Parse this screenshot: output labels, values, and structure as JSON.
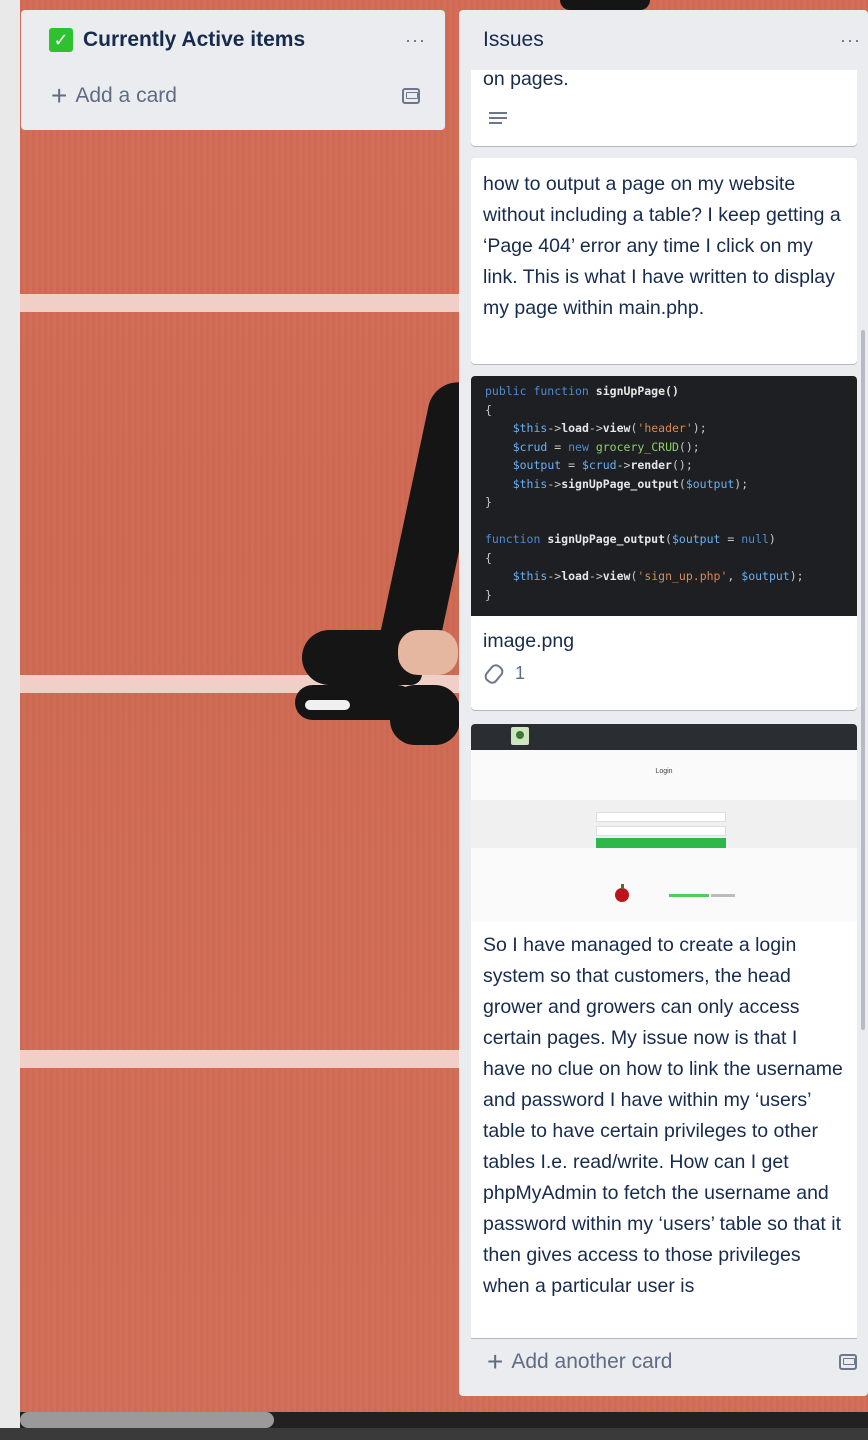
{
  "lists": {
    "active": {
      "title": "Currently Active items",
      "more": "···",
      "add_card": "Add a card"
    },
    "issues": {
      "title": "Issues",
      "more": "···",
      "add_card": "Add another card",
      "cards": [
        {
          "text": "on pages.",
          "has_description": true
        },
        {
          "text": "how to output a page on my website without including a table? I keep getting a ‘Page 404’ error any time I click on my link. This is what I have written to display my page within main.php."
        },
        {
          "attachment_name": "image.png",
          "attachment_count": "1"
        },
        {
          "text": "So I have managed to create a login system so that customers, the head grower and growers can only access certain pages. My issue now is that I have no clue on how to link the username and password I have within my ‘users’ table to have certain privileges to other tables I.e. read/write. How can I get phpMyAdmin to fetch the username and password within my ‘users’ table so that it then gives access to those privileges when a particular user is"
        }
      ]
    }
  },
  "code_screenshot": {
    "lines": [
      "public function signUpPage()",
      "{",
      "    $this->load->view('header');",
      "    $crud = new grocery_CRUD();",
      "    $output = $crud->render();",
      "    $this->signUpPage_output($output);",
      "}",
      "",
      "function signUpPage_output($output = null)",
      "{",
      "    $this->load->view('sign_up.php', $output);",
      "}"
    ]
  },
  "login_screenshot": {
    "title": "Login"
  },
  "colors": {
    "list_bg": "#ebecf0",
    "card_bg": "#ffffff",
    "text": "#172b4d",
    "muted": "#5e6c84",
    "check_green": "#2ec230",
    "track": "#d36c55"
  },
  "icons": [
    "check-icon",
    "more-icon",
    "plus-icon",
    "template-icon",
    "description-icon",
    "attachment-icon"
  ]
}
